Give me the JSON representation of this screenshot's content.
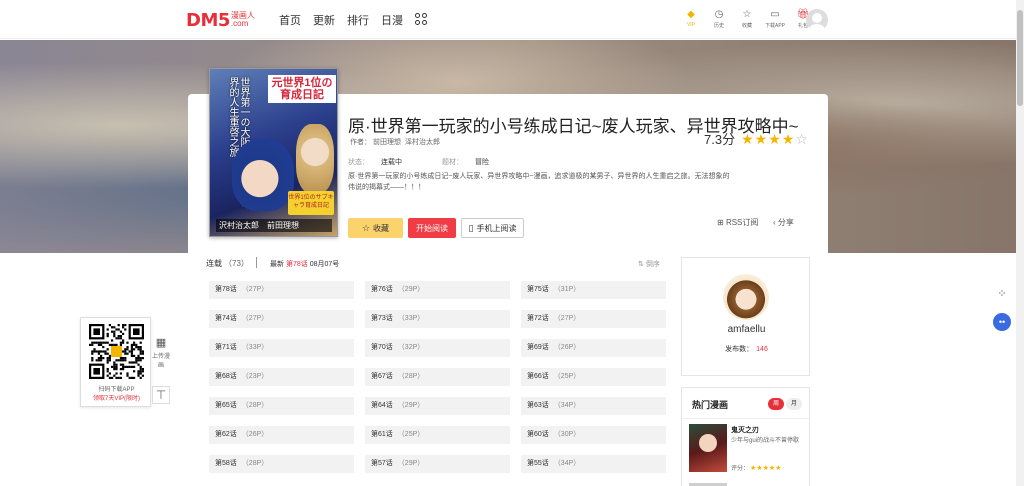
{
  "header": {
    "logo_main": "DM5",
    "logo_sub_top": "漫画人",
    "logo_sub_bottom": ".com",
    "nav": [
      "首页",
      "更新",
      "排行",
      "日漫"
    ],
    "tools": [
      {
        "icon": "diamond-icon",
        "label": "VIP"
      },
      {
        "icon": "clock-icon",
        "label": "历史"
      },
      {
        "icon": "star-icon",
        "label": "收藏"
      },
      {
        "icon": "monitor-icon",
        "label": "下载APP"
      },
      {
        "icon": "gift-icon",
        "label": "礼包"
      }
    ]
  },
  "comic": {
    "cover_title": "元世界1位の育成日記",
    "cover_side": "世界第一の大阪ゲーマー異世界的人生重啓之旅",
    "cover_authors": "沢村治太郎　前田理想",
    "cover_badge": "世界1位のサブキャラ育成日記",
    "title": "原·世界第一玩家的小号练成日记~废人玩家、异世界攻略中~",
    "score": "7.3分",
    "rating": 3.65,
    "author_label": "作者：",
    "authors": [
      "前田理想",
      "泽村治太郎"
    ],
    "status_label": "状态：",
    "status": "连载中",
    "genre_label": "题材：",
    "genre": "冒险",
    "description": "原·世界第一玩家的小号练成日记~废人玩家、异世界攻略中~漫画，追求道极的某男子、异世界的人生重启之旅。无法想象的伟说的揭幕式——！！！",
    "btn_collect": "收藏",
    "btn_read": "开始阅读",
    "btn_mobile": "手机上阅读",
    "rss": "RSS订阅",
    "share": "分享"
  },
  "chapter_list": {
    "label": "连载",
    "count": "（73）",
    "latest_prefix": "最新",
    "latest_chapter": "第78话",
    "latest_date": "08月07号",
    "sort": "倒序",
    "items": [
      {
        "name": "第78话",
        "pages": "（27P）"
      },
      {
        "name": "第76话",
        "pages": "（29P）"
      },
      {
        "name": "第75话",
        "pages": "（31P）"
      },
      {
        "name": "第74话",
        "pages": "（27P）"
      },
      {
        "name": "第73话",
        "pages": "（33P）"
      },
      {
        "name": "第72话",
        "pages": "（27P）"
      },
      {
        "name": "第71话",
        "pages": "（33P）"
      },
      {
        "name": "第70话",
        "pages": "（32P）"
      },
      {
        "name": "第69话",
        "pages": "（26P）"
      },
      {
        "name": "第68话",
        "pages": "（23P）"
      },
      {
        "name": "第67话",
        "pages": "（28P）"
      },
      {
        "name": "第66话",
        "pages": "（25P）"
      },
      {
        "name": "第65话",
        "pages": "（28P）"
      },
      {
        "name": "第64话",
        "pages": "（29P）"
      },
      {
        "name": "第63话",
        "pages": "（34P）"
      },
      {
        "name": "第62话",
        "pages": "（26P）"
      },
      {
        "name": "第61话",
        "pages": "（25P）"
      },
      {
        "name": "第60话",
        "pages": "（30P）"
      },
      {
        "name": "第58话",
        "pages": "（28P）"
      },
      {
        "name": "第57话",
        "pages": "（29P）"
      },
      {
        "name": "第55话",
        "pages": "（34P）"
      }
    ]
  },
  "uploader": {
    "name": "amfaellu",
    "pub_label": "发布数：",
    "pub_count": "146"
  },
  "hot": {
    "title": "热门漫画",
    "tab_week": "周",
    "tab_month": "月",
    "item_name": "鬼灭之刃",
    "item_desc": "少年与gui的战斗不曾停歇",
    "rate_label": "评分：",
    "rate_stars": "★★★★★"
  },
  "qr": {
    "line1": "扫码下载APP",
    "line2": "领取7天VIP(限时)"
  },
  "side": {
    "upload_label": "上传漫画",
    "top_label": "TOP"
  },
  "colors": {
    "brand": "#e5303a",
    "star": "#f5b400",
    "collect": "#fbd36d",
    "read": "#f03c45"
  }
}
